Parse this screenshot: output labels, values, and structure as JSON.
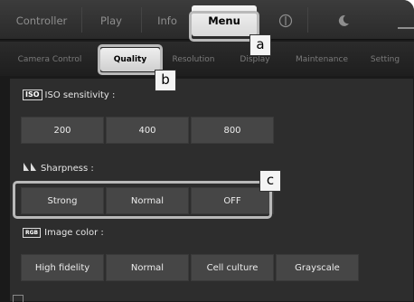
{
  "top_tabs": {
    "controller": "Controller",
    "play": "Play",
    "info": "Info",
    "menu": "Menu",
    "power_icon": "power-icon",
    "moon_icon": "moon-icon"
  },
  "sub_tabs": {
    "camera_control": "Camera Control",
    "quality": "Quality",
    "resolution": "Resolution",
    "display": "Display",
    "maintenance": "Maintenance",
    "setting": "Setting"
  },
  "iso": {
    "badge": "ISO",
    "label": "ISO sensitivity :",
    "options": [
      "200",
      "400",
      "800"
    ]
  },
  "sharpness": {
    "label": "Sharpness :",
    "options": [
      "Strong",
      "Normal",
      "OFF"
    ]
  },
  "image_color": {
    "badge": "RGB",
    "label": "Image color :",
    "options": [
      "High fidelity",
      "Normal",
      "Cell culture",
      "Grayscale"
    ]
  },
  "callouts": {
    "a": "a",
    "b": "b",
    "c": "c"
  },
  "colors": {
    "highlight_frame": "#b9b9b9",
    "button_bg": "#464646",
    "panel_bg": "#2d2d2d",
    "active_tab_bg": "#e6e6e6"
  }
}
